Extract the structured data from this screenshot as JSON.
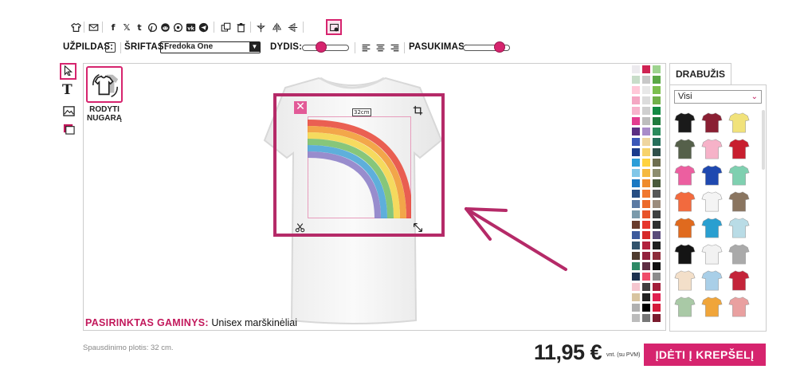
{
  "toolbar": {
    "icons": [
      "tshirt-icon",
      "mail-icon",
      "facebook-icon",
      "x-icon",
      "tumblr-icon",
      "pinterest-icon",
      "reddit-icon",
      "whatsapp-icon",
      "vk-icon",
      "telegram-icon",
      "duplicate-icon",
      "trash-icon",
      "align-center-icon",
      "flip-horizontal-icon",
      "flip-vertical-icon",
      "image-settings-icon"
    ],
    "fill_label": "UŽPILDAS:",
    "font_label": "ŠRIFTAS:",
    "font_value": "Fredoka One",
    "size_label": "DYDIS:",
    "size_level": 0.35,
    "rotation_label": "PASUKIMAS:",
    "rotation_level": 0.85
  },
  "tools": [
    "select-tool-icon",
    "text-tool-icon",
    "image-tool-icon",
    "clipart-tool-icon"
  ],
  "show_back_label": "RODYTI NUGARĄ",
  "design": {
    "size_tag": "32cm"
  },
  "selected": {
    "label": "PASIRINKTAS GAMINYS:",
    "value": "Unisex marškinėliai"
  },
  "print_width": "Spausdinimo plotis: 32 cm.",
  "price": "11,95 €",
  "price_note": "vnt. (su PVM)",
  "cart_button": "ĮDĖTI Į KREPŠELĮ",
  "clothing": {
    "tab": "DRABUŽIS",
    "filter": "Visi"
  },
  "colors": {
    "accent": "#c2185b",
    "accent_button": "#d6246e",
    "swatches": [
      "#eceaee",
      "#cf2353",
      "#9ed38f",
      "#c8ddc9",
      "#c8c8c8",
      "#5aa845",
      "#ffc8d8",
      "#e8e8e8",
      "#7cbf4e",
      "#f4a7c3",
      "#dcdcdc",
      "#71b04a",
      "#f7b3cc",
      "#cfcfcf",
      "#138a44",
      "#e33b8f",
      "#bdbdbd",
      "#1f7a3d",
      "#5a2d82",
      "#a88bc9",
      "#2a8a5c",
      "#3a57b8",
      "#efd6a0",
      "#276f5b",
      "#1a3b8c",
      "#f7d36b",
      "#30504a",
      "#2c9ed8",
      "#ffd23f",
      "#6e6e4e",
      "#82c7e8",
      "#f5b941",
      "#8d8d6e",
      "#1a78c2",
      "#ef8b2c",
      "#4a5a3a",
      "#284f83",
      "#f0782f",
      "#575757",
      "#5b7aa3",
      "#ec6a2b",
      "#9c8c7c",
      "#7a9aab",
      "#e8542b",
      "#404040",
      "#6a3c2c",
      "#e6362d",
      "#2e2e2e",
      "#3c5a9c",
      "#d62b2b",
      "#5b4a7a",
      "#31526c",
      "#b2223e",
      "#1f1f1f",
      "#4e3a2e",
      "#92223e",
      "#8d2b3a",
      "#2d8a66",
      "#5e2d43",
      "#111111",
      "#1c3150",
      "#f04d6a",
      "#8c8c8c",
      "#f5c6cf",
      "#3f3f3f",
      "#a31e3a",
      "#d8c4a0",
      "#222222",
      "#e02050",
      "#b0b0b0",
      "#000000",
      "#d41a3a",
      "#bcbcbc",
      "#777777",
      "#7a1c2e"
    ]
  }
}
